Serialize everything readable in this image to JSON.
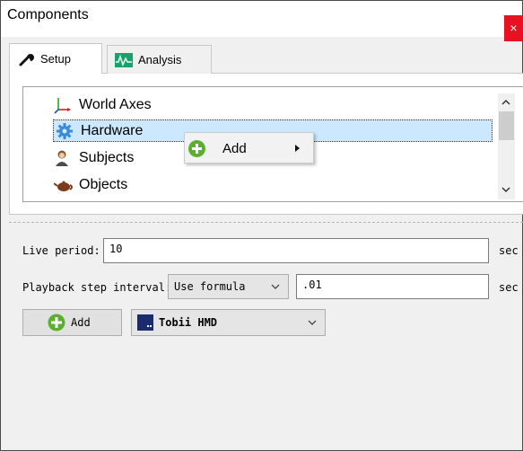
{
  "window": {
    "title": "Components",
    "close_glyph": "×"
  },
  "tabs": [
    {
      "label": "Setup",
      "icon": "wrench-icon",
      "active": true
    },
    {
      "label": "Analysis",
      "icon": "waveform-icon",
      "active": false
    }
  ],
  "tree": {
    "items": [
      {
        "label": "World Axes",
        "icon": "axes-icon",
        "selected": false
      },
      {
        "label": "Hardware",
        "icon": "gear-icon",
        "selected": true
      },
      {
        "label": "Subjects",
        "icon": "person-icon",
        "selected": false
      },
      {
        "label": "Objects",
        "icon": "teapot-icon",
        "selected": false
      }
    ]
  },
  "context_menu": {
    "items": [
      {
        "label": "Add",
        "icon": "plus-circle-icon",
        "has_submenu": true
      }
    ]
  },
  "form": {
    "live_period_label": "Live period:",
    "live_period_value": "10",
    "live_period_unit": "sec",
    "playback_label": "Playback step interval:",
    "playback_mode": "Use formula",
    "playback_value": ".01",
    "playback_unit": "sec"
  },
  "actions": {
    "add_label": "Add",
    "device_selected": "Tobii HMD",
    "device_icon": "tobii-icon"
  },
  "colors": {
    "selection": "#cce8ff",
    "close": "#e81123",
    "add_green": "#5bb12f"
  }
}
